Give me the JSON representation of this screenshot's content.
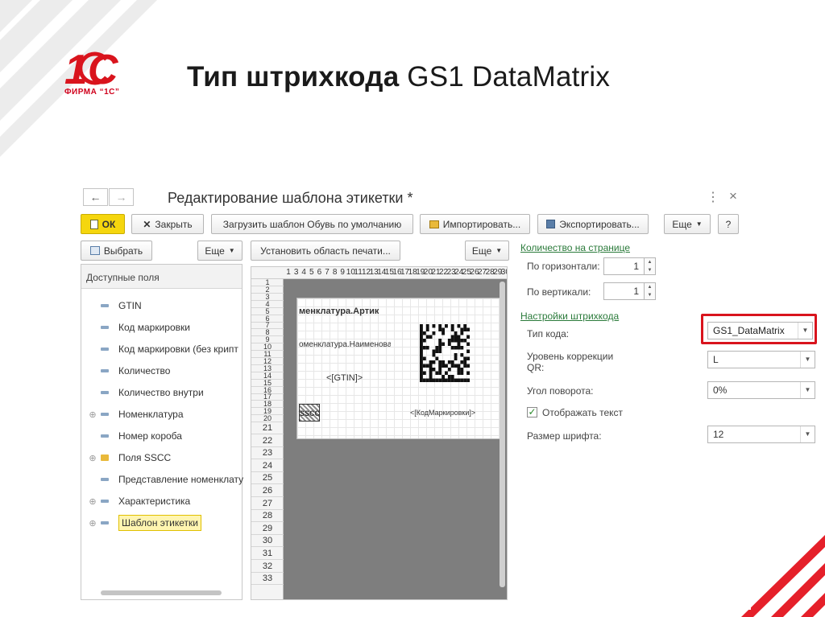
{
  "slide": {
    "title_bold": "Тип штрихкода",
    "title_rest": "GS1 DataMatrix",
    "logo_text": "1С",
    "logo_sub": "ФИРМА “1С”"
  },
  "colors": {
    "brand_red": "#d9141d",
    "button_yellow": "#f5d60e",
    "section_green": "#2a7a3a"
  },
  "window": {
    "title": "Редактирование шаблона этикетки *",
    "nav_back_icon": "arrow-left-icon",
    "nav_fwd_icon": "arrow-right-icon",
    "menu_glyph": "⋮",
    "close_glyph": "×",
    "toolbar": {
      "ok": "ОК",
      "close": "Закрыть",
      "load_default": "Загрузить шаблон Обувь по умолчанию",
      "import": "Импортировать...",
      "export": "Экспортировать...",
      "more": "Еще",
      "help": "?"
    },
    "left": {
      "select": "Выбрать",
      "more": "Еще",
      "header": "Доступные поля",
      "items": [
        {
          "label": "GTIN",
          "icon": "field-icon",
          "expandable": false
        },
        {
          "label": "Код маркировки",
          "icon": "field-icon",
          "expandable": false
        },
        {
          "label": "Код маркировки (без крипт",
          "icon": "field-icon",
          "expandable": false
        },
        {
          "label": "Количество",
          "icon": "field-icon",
          "expandable": false
        },
        {
          "label": "Количество внутри",
          "icon": "field-icon",
          "expandable": false
        },
        {
          "label": "Номенклатура",
          "icon": "field-icon",
          "expandable": true
        },
        {
          "label": "Номер короба",
          "icon": "field-icon",
          "expandable": false
        },
        {
          "label": "Поля SSCC",
          "icon": "folder-icon",
          "expandable": true
        },
        {
          "label": "Представление номенклату",
          "icon": "field-icon",
          "expandable": false
        },
        {
          "label": "Характеристика",
          "icon": "field-icon",
          "expandable": true
        },
        {
          "label": "Шаблон этикетки",
          "icon": "field-icon",
          "expandable": true,
          "selected": true
        }
      ]
    },
    "middle": {
      "set_print_area": "Установить область печати...",
      "more": "Еще",
      "col_headers": [
        "1",
        "3",
        "4",
        "5",
        "6",
        "7",
        "8",
        "9",
        "10",
        "11",
        "12",
        "13",
        "14",
        "15",
        "16",
        "17",
        "18",
        "19",
        "20",
        "21",
        "22",
        "23",
        "24",
        "25",
        "26",
        "27",
        "28",
        "29",
        "30"
      ],
      "row_headers": [
        "1",
        "2",
        "3",
        "4",
        "5",
        "6",
        "7",
        "8",
        "9",
        "10",
        "11",
        "12",
        "13",
        "14",
        "15",
        "16",
        "17",
        "18",
        "19",
        "20",
        "21",
        "22",
        "23",
        "24",
        "25",
        "26",
        "27",
        "28",
        "29",
        "30",
        "31",
        "32",
        "33"
      ],
      "label_nom_article": "менклатура.Артик",
      "label_nom_name": "оменклатура.Наименован",
      "label_gtin": "<[GTIN]>",
      "label_code": "<[КодМаркировки]>",
      "label_sscc": "SSCC"
    },
    "right": {
      "section_qty": "Количество на странице",
      "horiz_label": "По горизонтали:",
      "horiz_value": "1",
      "vert_label": "По вертикали:",
      "vert_value": "1",
      "section_barcode": "Настройки штрихкода",
      "code_type_label": "Тип кода:",
      "code_type_value": "GS1_DataMatrix",
      "correction_label": "Уровень коррекции QR:",
      "correction_value": "L",
      "rotation_label": "Угол поворота:",
      "rotation_value": "0%",
      "show_text_label": "Отображать текст",
      "show_text_checked": true,
      "font_size_label": "Размер шрифта:",
      "font_size_value": "12"
    }
  }
}
